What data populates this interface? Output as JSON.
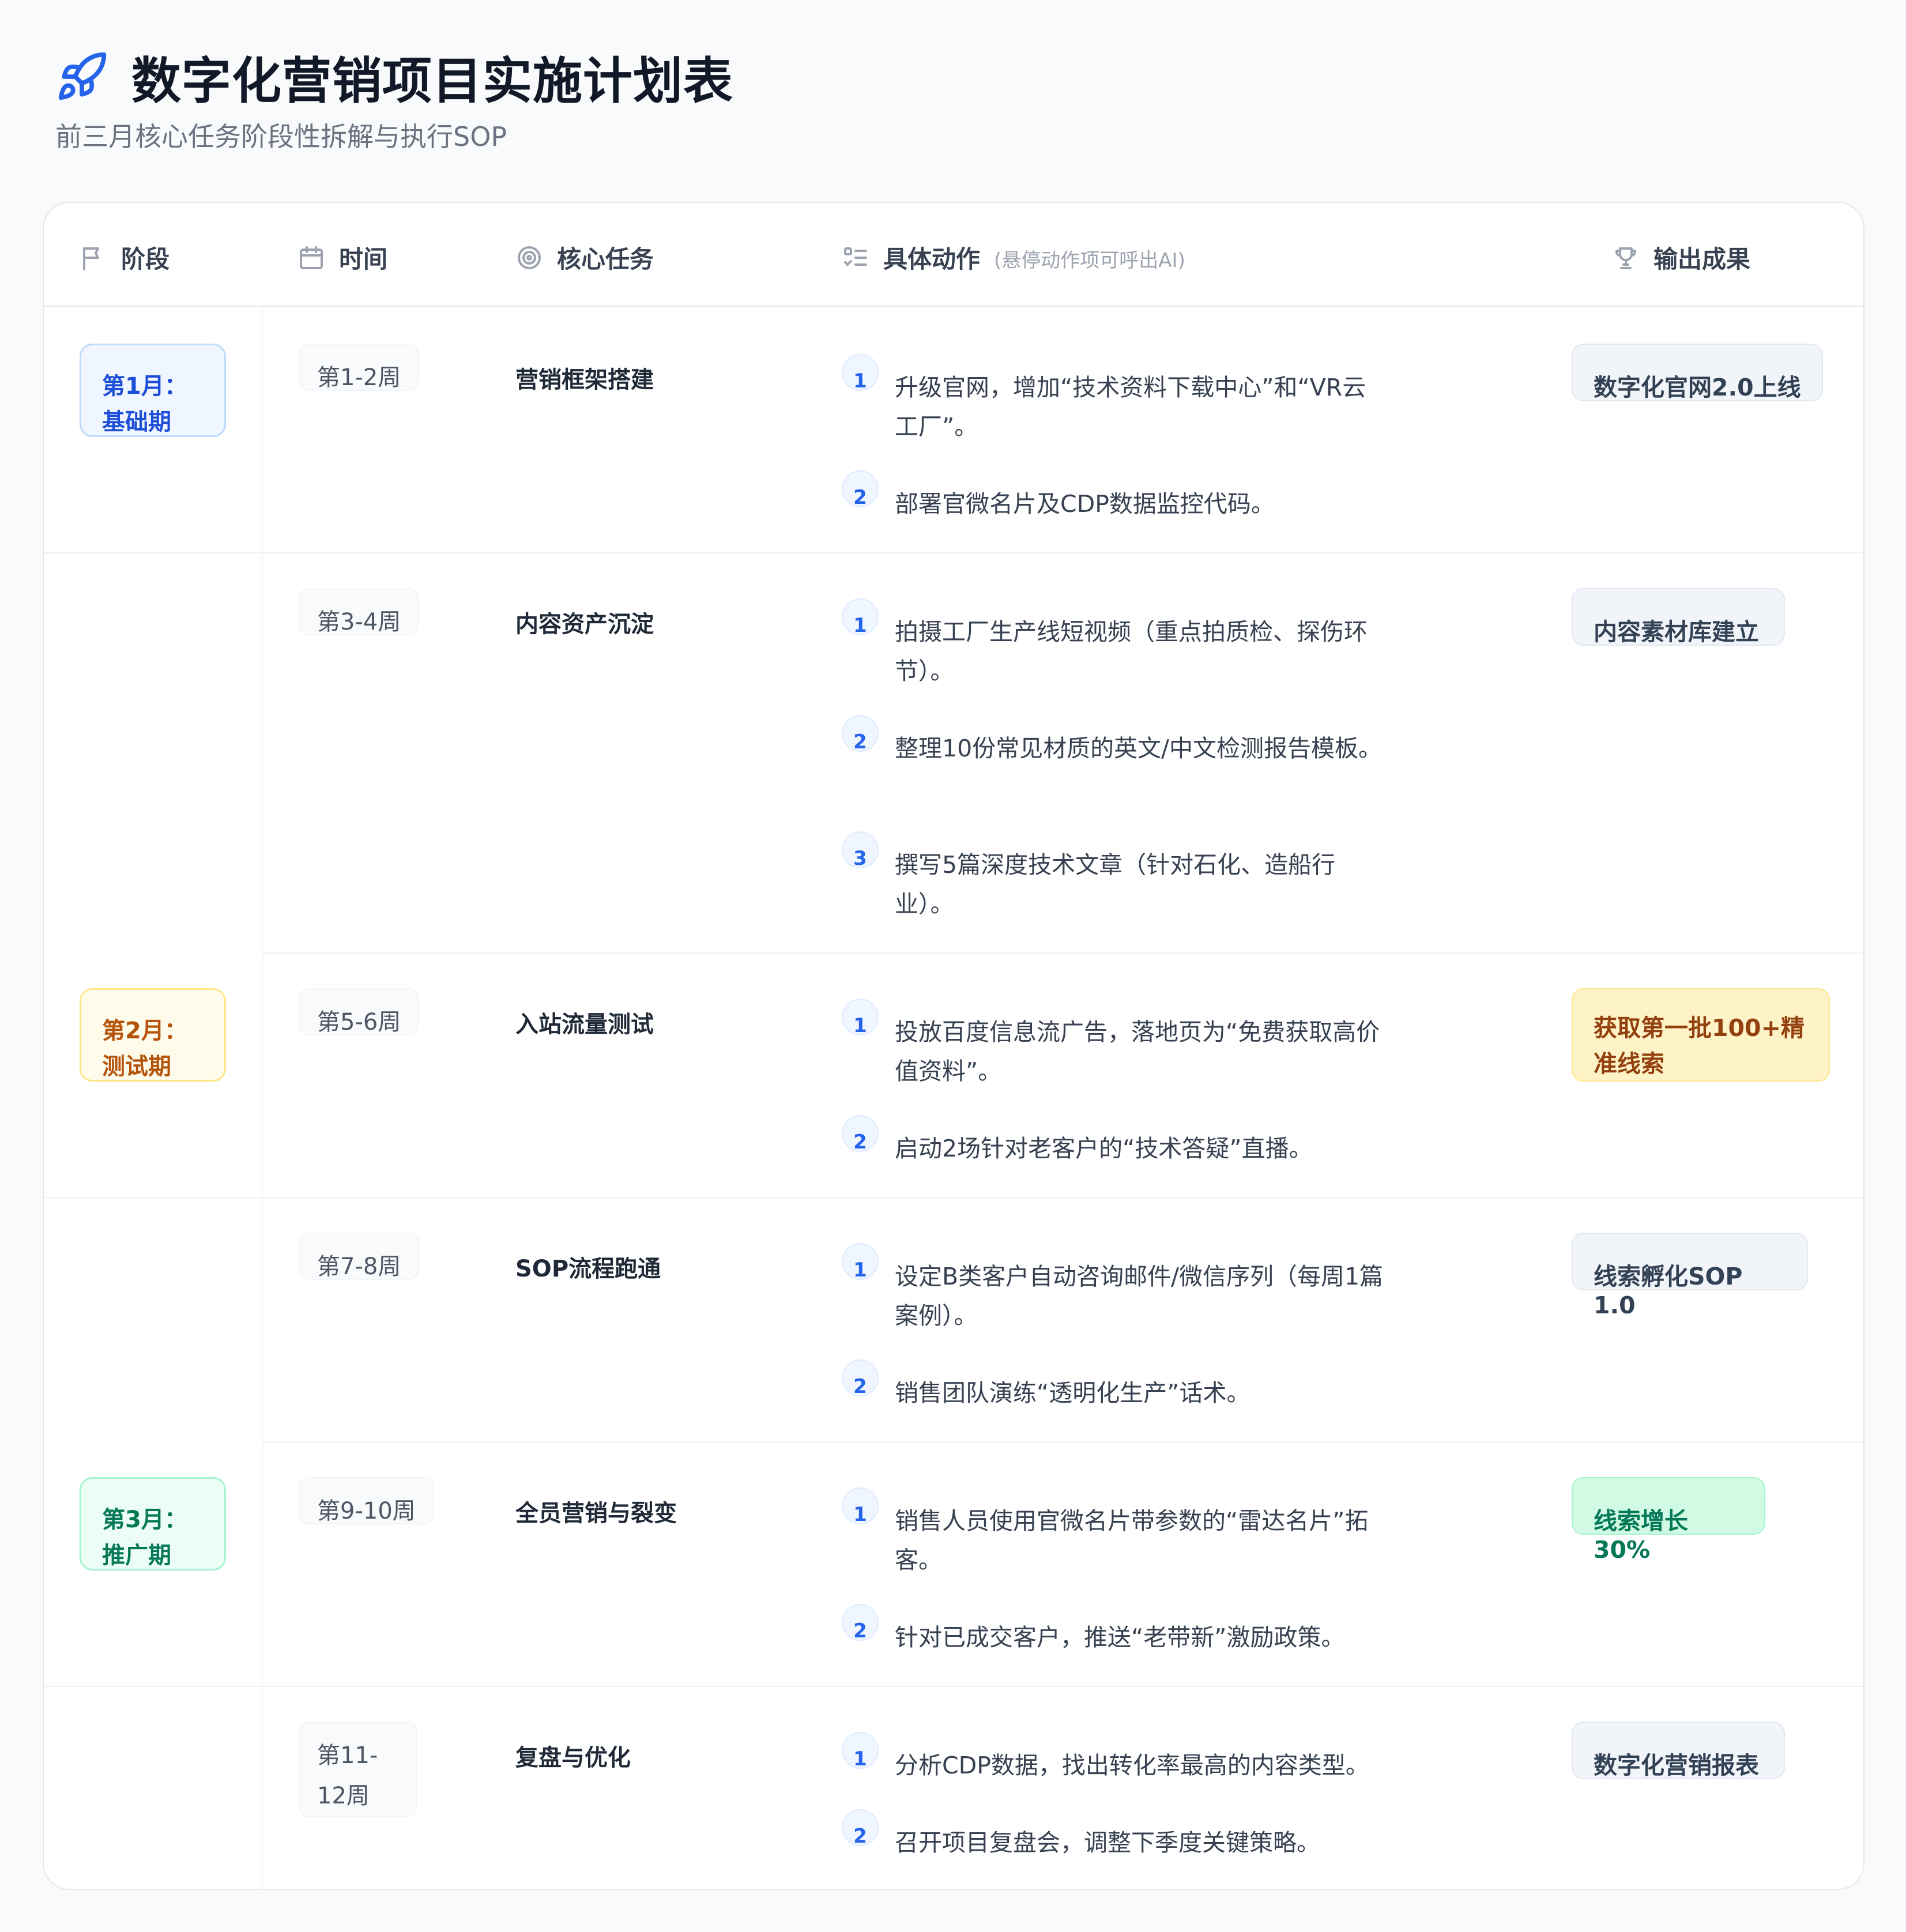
{
  "header": {
    "title": "数字化营销项目实施计划表",
    "subtitle": "前三月核心任务阶段性拆解与执行SOP",
    "icon": "rocket-icon"
  },
  "columns": {
    "phase": "阶段",
    "time": "时间",
    "task": "核心任务",
    "action": "具体动作",
    "action_hint": "(悬停动作项可呼出AI)",
    "output": "输出成果"
  },
  "phases": [
    {
      "line1": "第1月：",
      "line2": "基础期",
      "color": "#1d4ed8"
    },
    {
      "line1": "第2月：",
      "line2": "测试期",
      "color": "#b45309"
    },
    {
      "line1": "第3月：",
      "line2": "推广期",
      "color": "#047857"
    }
  ],
  "rows": [
    {
      "week": "第1-2周",
      "task": "营销框架搭建",
      "actions": [
        {
          "num": "1",
          "text": "升级官网，增加“技术资料下载中心”和“VR云工厂”。"
        },
        {
          "num": "2",
          "text": "部署官微名片及CDP数据监控代码。"
        }
      ],
      "output": "数字化官网2.0上线"
    },
    {
      "week": "第3-4周",
      "task": "内容资产沉淀",
      "actions": [
        {
          "num": "1",
          "text": "拍摄工厂生产线短视频（重点拍质检、探伤环节）。"
        },
        {
          "num": "2",
          "text": "整理10份常见材质的英文/中文检测报告模板。"
        },
        {
          "num": "3",
          "text": "撰写5篇深度技术文章（针对石化、造船行业）。"
        }
      ],
      "output": "内容素材库建立"
    },
    {
      "week": "第5-6周",
      "task": "入站流量测试",
      "actions": [
        {
          "num": "1",
          "text": "投放百度信息流广告，落地页为“免费获取高价值资料”。"
        },
        {
          "num": "2",
          "text": "启动2场针对老客户的“技术答疑”直播。"
        }
      ],
      "output": "获取第一批100+精准线索"
    },
    {
      "week": "第7-8周",
      "task": "SOP流程跑通",
      "actions": [
        {
          "num": "1",
          "text": "设定B类客户自动咨询邮件/微信序列（每周1篇案例）。"
        },
        {
          "num": "2",
          "text": "销售团队演练“透明化生产”话术。"
        }
      ],
      "output": "线索孵化SOP 1.0"
    },
    {
      "week": "第9-10周",
      "task": "全员营销与裂变",
      "actions": [
        {
          "num": "1",
          "text": "销售人员使用官微名片带参数的“雷达名片”拓客。"
        },
        {
          "num": "2",
          "text": "针对已成交客户，推送“老带新”激励政策。"
        }
      ],
      "output": "线索增长30%"
    },
    {
      "week": "第11-12周",
      "task": "复盘与优化",
      "actions": [
        {
          "num": "1",
          "text": "分析CDP数据，找出转化率最高的内容类型。"
        },
        {
          "num": "2",
          "text": "召开项目复盘会，调整下季度关键策略。"
        }
      ],
      "output": "数字化营销报表"
    }
  ]
}
